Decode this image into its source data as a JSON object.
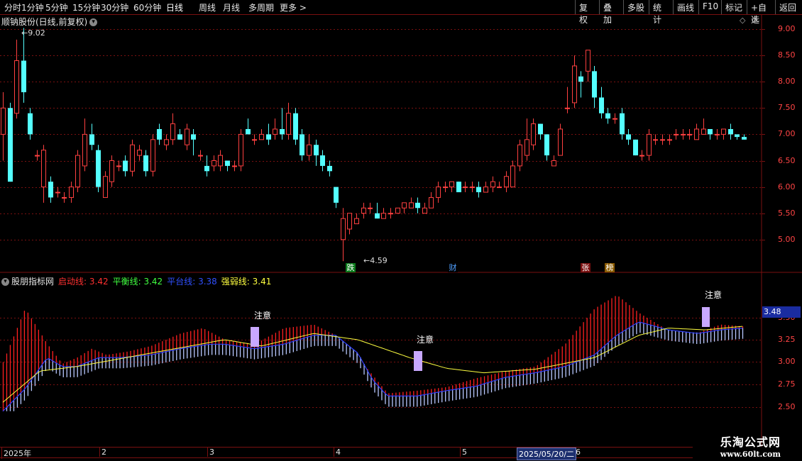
{
  "toolbar": {
    "periods": [
      "分时",
      "1分钟",
      "5分钟",
      "15分钟",
      "30分钟",
      "60分钟",
      "日线",
      "周线",
      "月线",
      "多周期",
      "更多"
    ],
    "more_arrow": ">",
    "active_index": 6,
    "right_buttons": [
      "复权",
      "叠加",
      "多股",
      "统计",
      "画线",
      "F10",
      "标记",
      "+自选",
      "返回"
    ]
  },
  "stock": {
    "title": "顺钠股份(日线,前复权)",
    "high_label": "9.02",
    "low_label": "4.59"
  },
  "price_axis": [
    "9.00",
    "8.50",
    "8.00",
    "7.50",
    "7.00",
    "6.50",
    "6.00",
    "5.50",
    "5.00"
  ],
  "events": [
    {
      "label": "跌",
      "bg": "#0a7a1a",
      "color": "#ffffff"
    },
    {
      "label": "财",
      "bg": "#000000",
      "color": "#50a0ff"
    },
    {
      "label": "张",
      "bg": "#7a1010",
      "color": "#ffffff"
    },
    {
      "label": "榜",
      "bg": "#8a5a00",
      "color": "#ffffff"
    }
  ],
  "indicator": {
    "name": "股朋指标网",
    "items": [
      {
        "label": "启动线:",
        "value": "3.42",
        "color": "#ff3030"
      },
      {
        "label": "平衡线:",
        "value": "3.42",
        "color": "#40ff40"
      },
      {
        "label": "平台线:",
        "value": "3.38",
        "color": "#3050ff"
      },
      {
        "label": "强弱线:",
        "value": "3.41",
        "color": "#ffff40"
      }
    ],
    "axis": [
      "3.25",
      "3.00",
      "2.75",
      "2.50"
    ],
    "axis_top_partial": "3.50",
    "current_tag": "3.48",
    "notes": [
      "注意",
      "注意",
      "注意"
    ]
  },
  "dates": {
    "labels": [
      "2025年",
      "2",
      "3",
      "4",
      "5",
      "6"
    ],
    "selected": "2025/05/20/二"
  },
  "watermark": {
    "line1": "乐淘公式网",
    "line2": "www.60lt.com"
  },
  "colors": {
    "up": "#ff4040",
    "down": "#54ffff",
    "grid": "#7a1010",
    "note": "#c8a8ff"
  }
}
